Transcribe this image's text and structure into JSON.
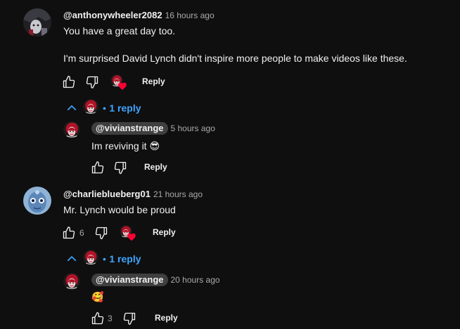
{
  "comments": [
    {
      "handle": "@anthonywheeler2082",
      "time": "16 hours ago",
      "text_line1": "You have a great day too.",
      "text_line2": "I'm surprised David Lynch didn't inspire more people to make videos like these.",
      "like_count": "",
      "reply_label": "Reply",
      "replies_toggle": "1 reply",
      "reply": {
        "handle": "@vivianstrange",
        "time": "5 hours ago",
        "text": "Im reviving it 😎",
        "like_count": "",
        "reply_label": "Reply"
      }
    },
    {
      "handle": "@charlieblueberg01",
      "time": "21 hours ago",
      "text": "Mr. Lynch would be proud",
      "like_count": "6",
      "reply_label": "Reply",
      "replies_toggle": "1 reply",
      "reply": {
        "handle": "@vivianstrange",
        "time": "20 hours ago",
        "text": "🥰",
        "like_count": "3",
        "reply_label": "Reply"
      }
    }
  ],
  "icons": {
    "like": "thumbs-up-icon",
    "dislike": "thumbs-down-icon",
    "heart": "creator-heart-icon",
    "chevron": "chevron-up-icon"
  },
  "colors": {
    "background": "#0f0f0f",
    "link": "#3ea6ff",
    "heart": "#ff0033",
    "muted": "#aaaaaa"
  }
}
